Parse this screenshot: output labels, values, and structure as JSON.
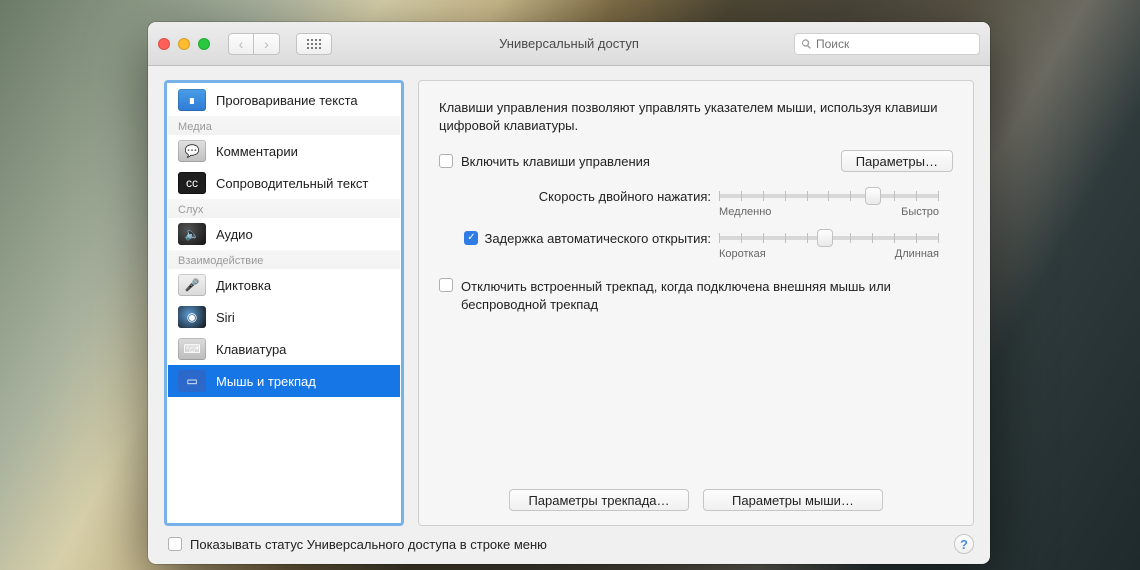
{
  "window": {
    "title": "Универсальный доступ",
    "search_placeholder": "Поиск"
  },
  "sidebar": {
    "sections": [
      {
        "header": "",
        "items": [
          {
            "label": "Проговаривание текста",
            "icon": "speech",
            "selected": false
          }
        ]
      },
      {
        "header": "Медиа",
        "items": [
          {
            "label": "Комментарии",
            "icon": "comments",
            "selected": false
          },
          {
            "label": "Сопроводительный текст",
            "icon": "caption",
            "selected": false
          }
        ]
      },
      {
        "header": "Слух",
        "items": [
          {
            "label": "Аудио",
            "icon": "audio",
            "selected": false
          }
        ]
      },
      {
        "header": "Взаимодействие",
        "items": [
          {
            "label": "Диктовка",
            "icon": "dict",
            "selected": false
          },
          {
            "label": "Siri",
            "icon": "siri",
            "selected": false
          },
          {
            "label": "Клавиатура",
            "icon": "keyboard",
            "selected": false
          },
          {
            "label": "Мышь и трекпад",
            "icon": "mouse",
            "selected": true
          }
        ]
      }
    ]
  },
  "panel": {
    "description": "Клавиши управления позволяют управлять указателем мыши, используя клавиши цифровой клавиатуры.",
    "enable_mouse_keys": {
      "label": "Включить клавиши управления",
      "checked": false
    },
    "options_button": "Параметры…",
    "double_click": {
      "label": "Скорость двойного нажатия:",
      "min": "Медленно",
      "max": "Быстро",
      "value_percent": 70
    },
    "spring_delay": {
      "checked": true,
      "label": "Задержка автоматического открытия:",
      "min": "Короткая",
      "max": "Длинная",
      "value_percent": 48
    },
    "ignore_trackpad": {
      "label": "Отключить встроенный трекпад, когда подключена внешняя мышь или беспроводной трекпад",
      "checked": false
    },
    "trackpad_options_button": "Параметры трекпада…",
    "mouse_options_button": "Параметры мыши…"
  },
  "footer": {
    "show_in_menubar": {
      "label": "Показывать статус Универсального доступа в строке меню",
      "checked": false
    }
  }
}
